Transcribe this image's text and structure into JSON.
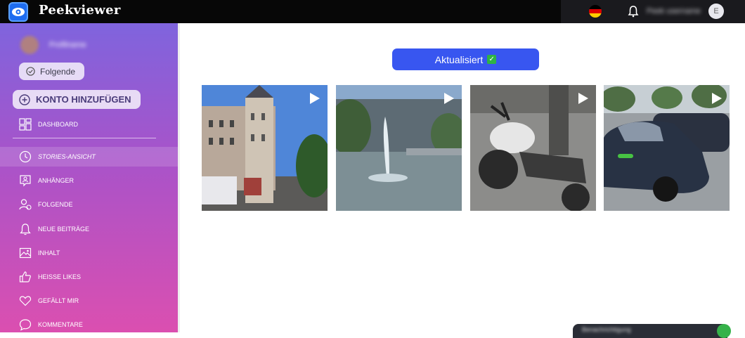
{
  "app": {
    "title": "Peekviewer"
  },
  "header": {
    "language_flag": "de-flag-icon",
    "username": "Peek username",
    "avatar_initial": "E"
  },
  "profile": {
    "name": "Profilname",
    "follow_label": "Folgende"
  },
  "sidebar": {
    "add_account_label": "KONTO HINZUFÜGEN",
    "dashboard_label": "DASHBOARD",
    "items": [
      {
        "label": "STORIES-ANSICHT",
        "icon": "clock-icon",
        "active": true
      },
      {
        "label": "ANHÄNGER",
        "icon": "followers-icon",
        "active": false
      },
      {
        "label": "FOLGENDE",
        "icon": "following-icon",
        "active": false
      },
      {
        "label": "NEUE BEITRÄGE",
        "icon": "bell-outline-icon",
        "active": false
      },
      {
        "label": "INHALT",
        "icon": "image-icon",
        "active": false
      },
      {
        "label": "HEISSE LIKES",
        "icon": "thumbs-up-icon",
        "active": false
      },
      {
        "label": "GEFÄLLT MIR",
        "icon": "heart-icon",
        "active": false
      },
      {
        "label": "KOMMENTARE",
        "icon": "comment-icon",
        "active": false
      }
    ]
  },
  "main": {
    "refresh_button": {
      "label": "Aktualisiert",
      "status": "✓"
    },
    "stories": [
      {
        "subject": "historic building with tower",
        "type": "video"
      },
      {
        "subject": "fountain in pond",
        "type": "video"
      },
      {
        "subject": "parked motorcycle",
        "type": "video"
      },
      {
        "subject": "parked dark car",
        "type": "video"
      }
    ]
  },
  "toast": {
    "text": "Benachrichtigung"
  },
  "colors": {
    "accent": "#3856f0",
    "sidebar_top": "#7f64dd",
    "sidebar_bottom": "#db4fb0",
    "topbar": "#070707"
  }
}
